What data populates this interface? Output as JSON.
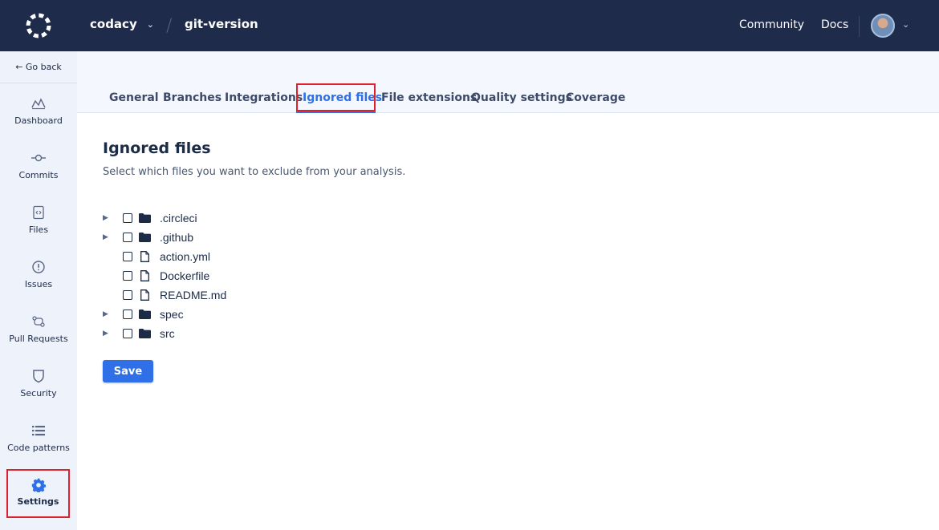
{
  "header": {
    "org": "codacy",
    "repo": "git-version",
    "links": {
      "community": "Community",
      "docs": "Docs"
    }
  },
  "sidebar": {
    "go_back": "← Go back",
    "items": [
      {
        "label": "Dashboard",
        "icon": "dashboard-icon"
      },
      {
        "label": "Commits",
        "icon": "commit-icon"
      },
      {
        "label": "Files",
        "icon": "file-code-icon"
      },
      {
        "label": "Issues",
        "icon": "issue-icon"
      },
      {
        "label": "Pull Requests",
        "icon": "pull-request-icon"
      },
      {
        "label": "Security",
        "icon": "shield-icon"
      },
      {
        "label": "Code patterns",
        "icon": "list-icon"
      },
      {
        "label": "Settings",
        "icon": "gear-icon",
        "active": true
      }
    ]
  },
  "tabs": [
    {
      "label": "General"
    },
    {
      "label": "Branches"
    },
    {
      "label": "Integrations"
    },
    {
      "label": "Ignored files",
      "active": true
    },
    {
      "label": "File extensions"
    },
    {
      "label": "Quality settings"
    },
    {
      "label": "Coverage"
    }
  ],
  "content": {
    "title": "Ignored files",
    "subtitle": "Select which files you want to exclude from your analysis.",
    "tree": [
      {
        "name": ".circleci",
        "type": "folder",
        "expandable": true,
        "checked": false
      },
      {
        "name": ".github",
        "type": "folder",
        "expandable": true,
        "checked": false
      },
      {
        "name": "action.yml",
        "type": "file",
        "expandable": false,
        "checked": false
      },
      {
        "name": "Dockerfile",
        "type": "file",
        "expandable": false,
        "checked": false
      },
      {
        "name": "README.md",
        "type": "file",
        "expandable": false,
        "checked": false
      },
      {
        "name": "spec",
        "type": "folder",
        "expandable": true,
        "checked": false
      },
      {
        "name": "src",
        "type": "folder",
        "expandable": true,
        "checked": false
      }
    ],
    "save_label": "Save"
  },
  "colors": {
    "topbar": "#1e2b4a",
    "sidebar": "#eef2fb",
    "accent": "#2f6fe8",
    "highlight_box": "#e0202a"
  }
}
